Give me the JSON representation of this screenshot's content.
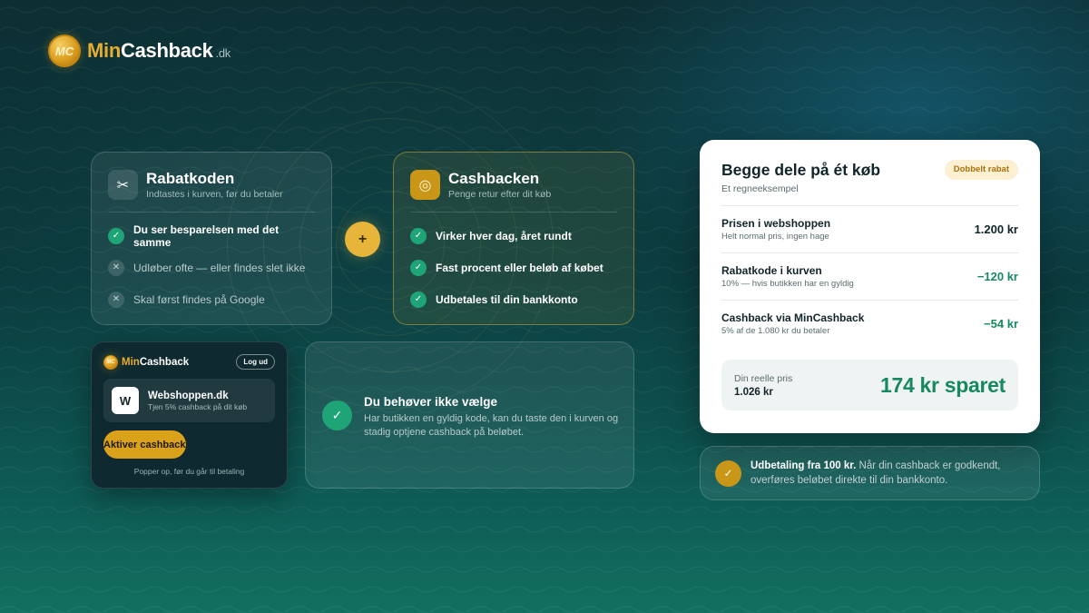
{
  "brand": {
    "min": "Min",
    "cashback": "Cashback",
    "tld": ".dk",
    "coin": "MC"
  },
  "colors": {
    "accent_gold": "#e8b53b",
    "accent_green": "#1ea476",
    "bg_dark": "#0d2f34"
  },
  "rabatkode": {
    "icon": "scissors-icon",
    "title": "Rabatkoden",
    "subtitle": "Indtastes i kurven, før du betaler",
    "items": [
      {
        "text": "Du ser besparelsen med det samme",
        "status": "ok"
      },
      {
        "text": "Udløber ofte — eller findes slet ikke",
        "status": "no"
      },
      {
        "text": "Skal først findes på Google",
        "status": "no"
      }
    ]
  },
  "plus": "+",
  "cashback_card": {
    "icon": "target-icon",
    "title": "Cashbacken",
    "subtitle": "Penge retur efter dit køb",
    "items": [
      {
        "text": "Virker hver dag, året rundt",
        "status": "ok"
      },
      {
        "text": "Fast procent eller beløb af købet",
        "status": "ok"
      },
      {
        "text": "Udbetales til din bankkonto",
        "status": "ok"
      }
    ]
  },
  "popup": {
    "brand_min": "Min",
    "brand_cashback": "Cashback",
    "logout_label": "Log ud",
    "shop_letter": "W",
    "shop_name": "Webshoppen.dk",
    "shop_sub": "Tjen 5% cashback på dit køb",
    "activate_label": "Aktiver cashback",
    "note": "Popper op, før du går til betaling"
  },
  "info": {
    "title": "Du behøver ikke vælge",
    "body": "Har butikken en gyldig kode, kan du taste den i kurven og stadig optjene cashback på beløbet."
  },
  "calc": {
    "title": "Begge dele på ét køb",
    "subtitle": "Et regneeksempel",
    "badge": "Dobbelt rabat",
    "rows": [
      {
        "label": "Prisen i webshoppen",
        "sub": "Helt normal pris, ingen hage",
        "value": "1.200 kr",
        "tone": "neutral"
      },
      {
        "label": "Rabatkode i kurven",
        "sub": "10% — hvis butikken har en gyldig",
        "value": "−120 kr",
        "tone": "green"
      },
      {
        "label": "Cashback via MinCashback",
        "sub": "5% af de 1.080 kr du betaler",
        "value": "−54 kr",
        "tone": "green"
      }
    ],
    "total_label": "Din reelle pris",
    "total_price": "1.026 kr",
    "total_saved": "174 kr sparet"
  },
  "payout": {
    "bold": "Udbetaling fra 100 kr.",
    "text": " Når din cashback er godkendt, overføres beløbet direkte til din bankkonto."
  }
}
